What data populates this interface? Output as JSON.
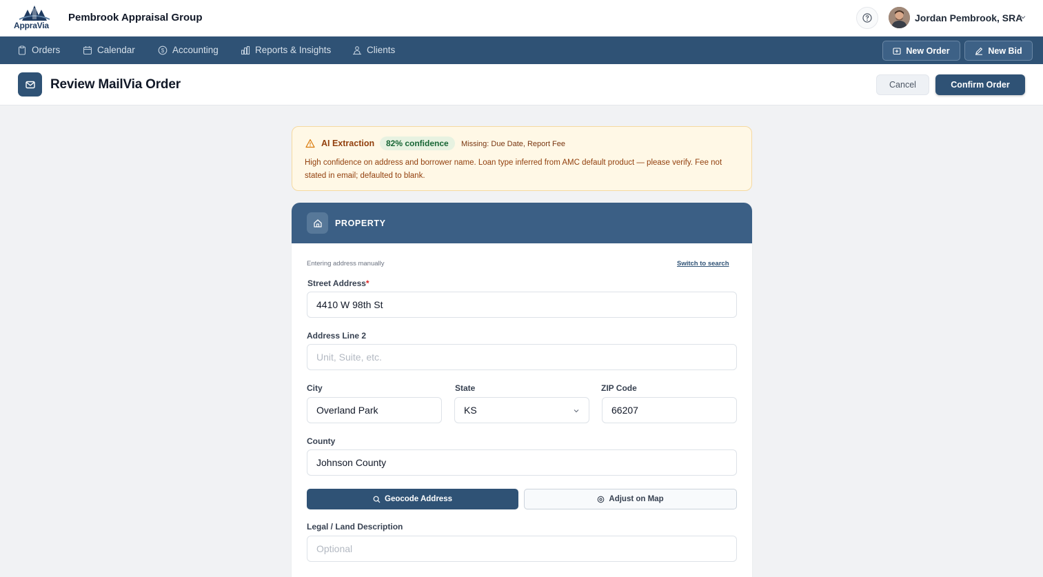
{
  "header": {
    "logo_text": "ApprаVia",
    "company_name": "Pembrook Appraisal Group",
    "user_name": "Jordan Pembrook, SRA"
  },
  "nav": {
    "items": [
      {
        "label": "Orders",
        "icon": "clipboard-icon"
      },
      {
        "label": "Calendar",
        "icon": "calendar-icon"
      },
      {
        "label": "Accounting",
        "icon": "dollar-icon"
      },
      {
        "label": "Reports & Insights",
        "icon": "bar-chart-icon"
      },
      {
        "label": "Clients",
        "icon": "users-icon"
      }
    ],
    "new_order_label": "New Order",
    "new_bid_label": "New Bid"
  },
  "page": {
    "title": "Review MailVia Order",
    "cancel_label": "Cancel",
    "confirm_label": "Confirm Order"
  },
  "alert": {
    "title": "AI Extraction",
    "confidence": "82% confidence",
    "missing": "Missing: Due Date, Report Fee",
    "body": "High confidence on address and borrower name. Loan type inferred from AMC default product — please verify. Fee not stated in email; defaulted to blank."
  },
  "property": {
    "section_title": "PROPERTY",
    "manual_note": "Entering address manually",
    "switch_link": "Switch to search",
    "street_label": "Street Address",
    "street_value": "4410 W 98th St",
    "line2_label": "Address Line 2",
    "line2_placeholder": "Unit, Suite, etc.",
    "city_label": "City",
    "city_value": "Overland Park",
    "state_label": "State",
    "state_value": "KS",
    "zip_label": "ZIP Code",
    "zip_value": "66207",
    "county_label": "County",
    "county_value": "Johnson County",
    "geocode_label": "Geocode Address",
    "map_label": "Adjust on Map",
    "legal_label": "Legal / Land Description",
    "legal_placeholder": "Optional"
  },
  "colors": {
    "navy": "#2f5275",
    "card_header": "#3b5f85",
    "alert_bg": "#fff8e6",
    "confidence_green": "#166534"
  }
}
